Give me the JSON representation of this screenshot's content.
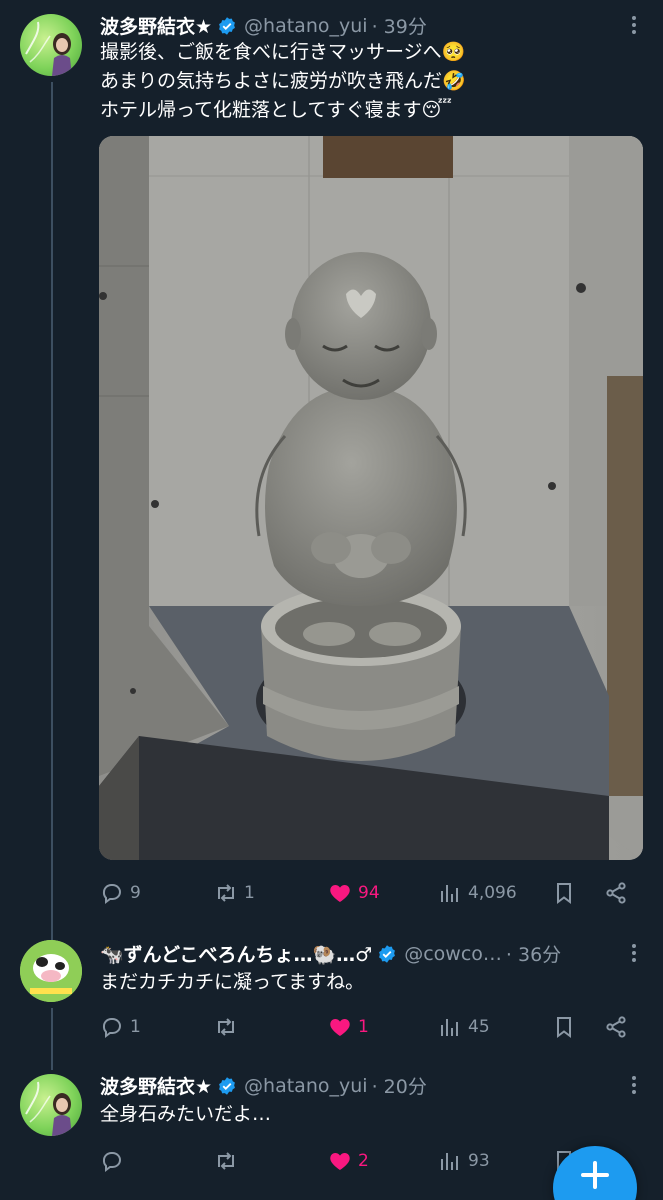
{
  "colors": {
    "background": "#15202b",
    "accent": "#1d9bf0",
    "like": "#f91880",
    "muted": "#8b98a5"
  },
  "tweets": [
    {
      "name": "波多野結衣★",
      "handle": "@hatano_yui",
      "time": "· 39分",
      "lines": [
        "撮影後、ご飯を食べに行きマッサージへ🥺",
        "あまりの気持ちよさに疲労が吹き飛んだ🤣",
        "ホテル帰って化粧落としてすぐ寝ます😴"
      ],
      "replies": "9",
      "retweets": "1",
      "likes": "94",
      "views": "4,096"
    },
    {
      "name": "🐄ずんどこべろんちょ…🐏…♂",
      "handle": "@cowco…",
      "time": "· 36分",
      "lines": [
        "まだカチカチに凝ってますね。"
      ],
      "replies": "1",
      "retweets": "",
      "likes": "1",
      "views": "45"
    },
    {
      "name": "波多野結衣★",
      "handle": "@hatano_yui",
      "time": "· 20分",
      "lines": [
        "全身石みたいだよ…"
      ],
      "replies": "",
      "retweets": "",
      "likes": "2",
      "views": "93"
    }
  ],
  "icons": [
    "reply-icon",
    "retweet-icon",
    "heart-icon",
    "views-icon",
    "bookmark-icon",
    "share-icon",
    "verified-icon",
    "more-icon",
    "compose-plus-icon"
  ]
}
